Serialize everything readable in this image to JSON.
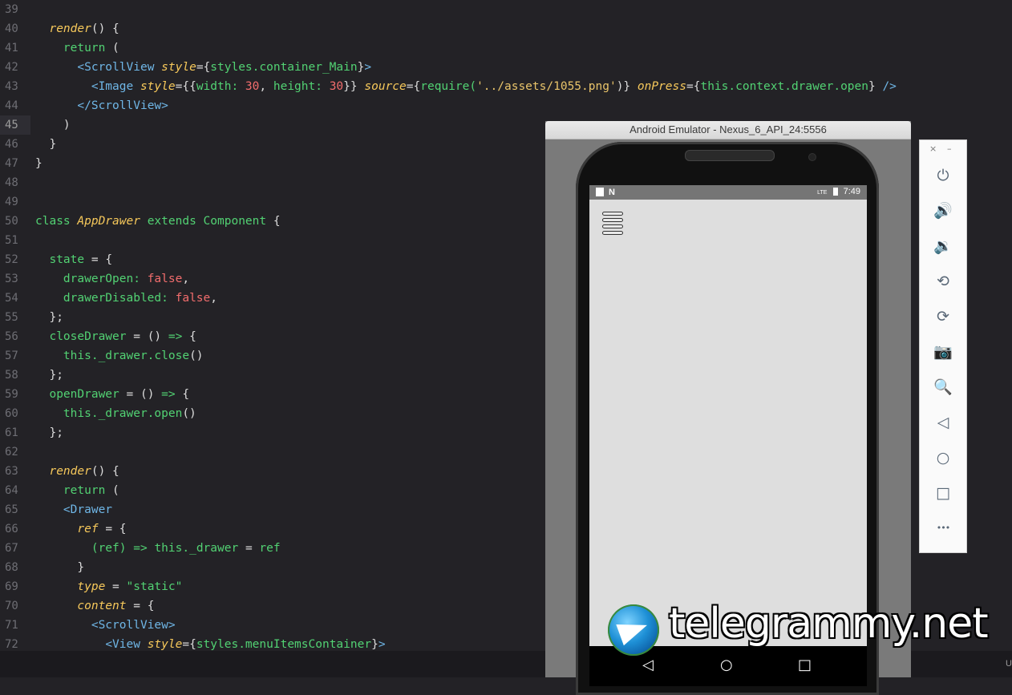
{
  "editor": {
    "active_line": "45",
    "lines": [
      {
        "n": "39",
        "tokens": []
      },
      {
        "n": "40",
        "tokens": [
          [
            "  ",
            "plain"
          ],
          [
            "render",
            "fn"
          ],
          [
            "() {",
            "plain"
          ]
        ]
      },
      {
        "n": "41",
        "tokens": [
          [
            "    ",
            "plain"
          ],
          [
            "return",
            "kw"
          ],
          [
            " (",
            "plain"
          ]
        ]
      },
      {
        "n": "42",
        "tokens": [
          [
            "      ",
            "plain"
          ],
          [
            "<ScrollView ",
            "tag"
          ],
          [
            "style",
            "attr"
          ],
          [
            "={",
            "plain"
          ],
          [
            "styles.container_Main",
            "green"
          ],
          [
            "}",
            "plain"
          ],
          [
            ">",
            "tag"
          ]
        ]
      },
      {
        "n": "43",
        "tokens": [
          [
            "        ",
            "plain"
          ],
          [
            "<Image ",
            "tag"
          ],
          [
            "style",
            "attr"
          ],
          [
            "={{",
            "plain"
          ],
          [
            "width: ",
            "green"
          ],
          [
            "30",
            "red"
          ],
          [
            ", ",
            "plain"
          ],
          [
            "height: ",
            "green"
          ],
          [
            "30",
            "red"
          ],
          [
            "}} ",
            "plain"
          ],
          [
            "source",
            "attr"
          ],
          [
            "={",
            "plain"
          ],
          [
            "require(",
            "green"
          ],
          [
            "'../assets/1055.png'",
            "str"
          ],
          [
            ")} ",
            "plain"
          ],
          [
            "onPress",
            "attr"
          ],
          [
            "={",
            "plain"
          ],
          [
            "this.context.drawer.open",
            "green"
          ],
          [
            "} ",
            "plain"
          ],
          [
            "/>",
            "tag"
          ]
        ]
      },
      {
        "n": "44",
        "tokens": [
          [
            "      ",
            "plain"
          ],
          [
            "</ScrollView>",
            "tag"
          ]
        ]
      },
      {
        "n": "45",
        "tokens": [
          [
            "    )",
            "plain"
          ]
        ]
      },
      {
        "n": "46",
        "tokens": [
          [
            "  }",
            "plain"
          ]
        ]
      },
      {
        "n": "47",
        "tokens": [
          [
            "}",
            "plain"
          ]
        ]
      },
      {
        "n": "48",
        "tokens": []
      },
      {
        "n": "49",
        "tokens": []
      },
      {
        "n": "50",
        "tokens": [
          [
            "class ",
            "green"
          ],
          [
            "AppDrawer ",
            "fn"
          ],
          [
            "extends ",
            "green"
          ],
          [
            "Component ",
            "green"
          ],
          [
            "{",
            "plain"
          ]
        ]
      },
      {
        "n": "51",
        "tokens": []
      },
      {
        "n": "52",
        "tokens": [
          [
            "  ",
            "plain"
          ],
          [
            "state ",
            "green"
          ],
          [
            "= {",
            "plain"
          ]
        ]
      },
      {
        "n": "53",
        "tokens": [
          [
            "    ",
            "plain"
          ],
          [
            "drawerOpen: ",
            "green"
          ],
          [
            "false",
            "red"
          ],
          [
            ",",
            "plain"
          ]
        ]
      },
      {
        "n": "54",
        "tokens": [
          [
            "    ",
            "plain"
          ],
          [
            "drawerDisabled: ",
            "green"
          ],
          [
            "false",
            "red"
          ],
          [
            ",",
            "plain"
          ]
        ]
      },
      {
        "n": "55",
        "tokens": [
          [
            "  };",
            "plain"
          ]
        ]
      },
      {
        "n": "56",
        "tokens": [
          [
            "  ",
            "plain"
          ],
          [
            "closeDrawer ",
            "green"
          ],
          [
            "= () ",
            "plain"
          ],
          [
            "=> ",
            "green"
          ],
          [
            "{",
            "plain"
          ]
        ]
      },
      {
        "n": "57",
        "tokens": [
          [
            "    ",
            "plain"
          ],
          [
            "this._drawer.close",
            "green"
          ],
          [
            "()",
            "plain"
          ]
        ]
      },
      {
        "n": "58",
        "tokens": [
          [
            "  };",
            "plain"
          ]
        ]
      },
      {
        "n": "59",
        "tokens": [
          [
            "  ",
            "plain"
          ],
          [
            "openDrawer ",
            "green"
          ],
          [
            "= () ",
            "plain"
          ],
          [
            "=> ",
            "green"
          ],
          [
            "{",
            "plain"
          ]
        ]
      },
      {
        "n": "60",
        "tokens": [
          [
            "    ",
            "plain"
          ],
          [
            "this._drawer.open",
            "green"
          ],
          [
            "()",
            "plain"
          ]
        ]
      },
      {
        "n": "61",
        "tokens": [
          [
            "  };",
            "plain"
          ]
        ]
      },
      {
        "n": "62",
        "tokens": []
      },
      {
        "n": "63",
        "tokens": [
          [
            "  ",
            "plain"
          ],
          [
            "render",
            "fn"
          ],
          [
            "() {",
            "plain"
          ]
        ]
      },
      {
        "n": "64",
        "tokens": [
          [
            "    ",
            "plain"
          ],
          [
            "return",
            "kw"
          ],
          [
            " (",
            "plain"
          ]
        ]
      },
      {
        "n": "65",
        "tokens": [
          [
            "    ",
            "plain"
          ],
          [
            "<Drawer",
            "tag"
          ]
        ]
      },
      {
        "n": "66",
        "tokens": [
          [
            "      ",
            "plain"
          ],
          [
            "ref",
            "attr"
          ],
          [
            " = {",
            "plain"
          ]
        ]
      },
      {
        "n": "67",
        "tokens": [
          [
            "        ",
            "plain"
          ],
          [
            "(ref) ",
            "green"
          ],
          [
            "=> ",
            "green"
          ],
          [
            "this._drawer ",
            "green"
          ],
          [
            "= ",
            "plain"
          ],
          [
            "ref",
            "green"
          ]
        ]
      },
      {
        "n": "68",
        "tokens": [
          [
            "      }",
            "plain"
          ]
        ]
      },
      {
        "n": "69",
        "tokens": [
          [
            "      ",
            "plain"
          ],
          [
            "type",
            "attr"
          ],
          [
            " = ",
            "plain"
          ],
          [
            "\"static\"",
            "green"
          ]
        ]
      },
      {
        "n": "70",
        "tokens": [
          [
            "      ",
            "plain"
          ],
          [
            "content",
            "attr"
          ],
          [
            " = {",
            "plain"
          ]
        ]
      },
      {
        "n": "71",
        "tokens": [
          [
            "        ",
            "plain"
          ],
          [
            "<ScrollView>",
            "tag"
          ]
        ]
      },
      {
        "n": "72",
        "tokens": [
          [
            "          ",
            "plain"
          ],
          [
            "<View ",
            "tag"
          ],
          [
            "style",
            "attr"
          ],
          [
            "={",
            "plain"
          ],
          [
            "styles.menuItemsContainer",
            "green"
          ],
          [
            "}",
            "plain"
          ],
          [
            ">",
            "tag"
          ]
        ]
      }
    ]
  },
  "statusbar": {
    "text": "U"
  },
  "emulator": {
    "title": "Android Emulator - Nexus_6_API_24:5556",
    "status_time": "7:49",
    "status_network": "LTE"
  },
  "toolbar": {
    "close_glyph": "×",
    "minimize_glyph": "–",
    "buttons": [
      {
        "name": "power-icon",
        "glyph": "⏻"
      },
      {
        "name": "volume-up-icon",
        "glyph": "🔊"
      },
      {
        "name": "volume-down-icon",
        "glyph": "🔉"
      },
      {
        "name": "rotate-left-icon",
        "glyph": "⟲"
      },
      {
        "name": "rotate-right-icon",
        "glyph": "⟳"
      },
      {
        "name": "camera-icon",
        "glyph": "📷"
      },
      {
        "name": "zoom-icon",
        "glyph": "🔍"
      },
      {
        "name": "back-icon",
        "glyph": "◁"
      },
      {
        "name": "home-icon",
        "glyph": "○"
      },
      {
        "name": "overview-icon",
        "glyph": "□"
      },
      {
        "name": "more-icon",
        "glyph": "•••"
      }
    ]
  },
  "watermark": {
    "text": "telegrammy.net"
  }
}
